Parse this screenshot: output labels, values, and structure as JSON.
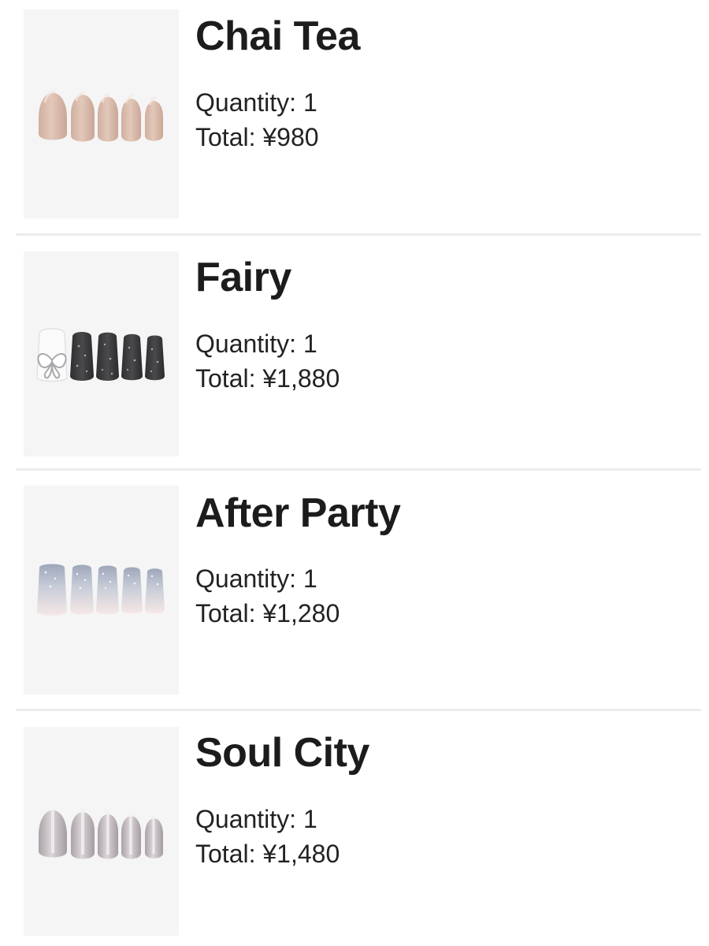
{
  "items": [
    {
      "name": "Chai Tea",
      "quantity_label": "Quantity: 1",
      "total_label": "Total: ¥980",
      "image_icon": "nail-set-nude-oval"
    },
    {
      "name": "Fairy",
      "quantity_label": "Quantity: 1",
      "total_label": "Total: ¥1,880",
      "image_icon": "nail-set-black-glitter-butterfly"
    },
    {
      "name": "After Party",
      "quantity_label": "Quantity: 1",
      "total_label": "Total: ¥1,280",
      "image_icon": "nail-set-silver-glitter-ombre"
    },
    {
      "name": "Soul City",
      "quantity_label": "Quantity: 1",
      "total_label": "Total: ¥1,480",
      "image_icon": "nail-set-grey-chrome-oval"
    }
  ],
  "colors": {
    "thumb_background": "#f5f5f5",
    "divider": "#ececec",
    "text": "#1f1f1f"
  }
}
